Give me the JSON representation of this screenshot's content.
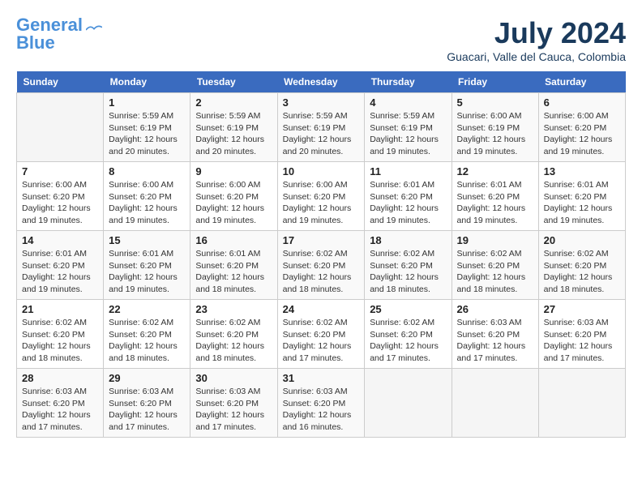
{
  "header": {
    "logo_line1": "General",
    "logo_line2": "Blue",
    "month": "July 2024",
    "location": "Guacari, Valle del Cauca, Colombia"
  },
  "weekdays": [
    "Sunday",
    "Monday",
    "Tuesday",
    "Wednesday",
    "Thursday",
    "Friday",
    "Saturday"
  ],
  "weeks": [
    [
      {
        "day": "",
        "info": ""
      },
      {
        "day": "1",
        "info": "Sunrise: 5:59 AM\nSunset: 6:19 PM\nDaylight: 12 hours\nand 20 minutes."
      },
      {
        "day": "2",
        "info": "Sunrise: 5:59 AM\nSunset: 6:19 PM\nDaylight: 12 hours\nand 20 minutes."
      },
      {
        "day": "3",
        "info": "Sunrise: 5:59 AM\nSunset: 6:19 PM\nDaylight: 12 hours\nand 20 minutes."
      },
      {
        "day": "4",
        "info": "Sunrise: 5:59 AM\nSunset: 6:19 PM\nDaylight: 12 hours\nand 19 minutes."
      },
      {
        "day": "5",
        "info": "Sunrise: 6:00 AM\nSunset: 6:19 PM\nDaylight: 12 hours\nand 19 minutes."
      },
      {
        "day": "6",
        "info": "Sunrise: 6:00 AM\nSunset: 6:20 PM\nDaylight: 12 hours\nand 19 minutes."
      }
    ],
    [
      {
        "day": "7",
        "info": "Sunrise: 6:00 AM\nSunset: 6:20 PM\nDaylight: 12 hours\nand 19 minutes."
      },
      {
        "day": "8",
        "info": "Sunrise: 6:00 AM\nSunset: 6:20 PM\nDaylight: 12 hours\nand 19 minutes."
      },
      {
        "day": "9",
        "info": "Sunrise: 6:00 AM\nSunset: 6:20 PM\nDaylight: 12 hours\nand 19 minutes."
      },
      {
        "day": "10",
        "info": "Sunrise: 6:00 AM\nSunset: 6:20 PM\nDaylight: 12 hours\nand 19 minutes."
      },
      {
        "day": "11",
        "info": "Sunrise: 6:01 AM\nSunset: 6:20 PM\nDaylight: 12 hours\nand 19 minutes."
      },
      {
        "day": "12",
        "info": "Sunrise: 6:01 AM\nSunset: 6:20 PM\nDaylight: 12 hours\nand 19 minutes."
      },
      {
        "day": "13",
        "info": "Sunrise: 6:01 AM\nSunset: 6:20 PM\nDaylight: 12 hours\nand 19 minutes."
      }
    ],
    [
      {
        "day": "14",
        "info": "Sunrise: 6:01 AM\nSunset: 6:20 PM\nDaylight: 12 hours\nand 19 minutes."
      },
      {
        "day": "15",
        "info": "Sunrise: 6:01 AM\nSunset: 6:20 PM\nDaylight: 12 hours\nand 19 minutes."
      },
      {
        "day": "16",
        "info": "Sunrise: 6:01 AM\nSunset: 6:20 PM\nDaylight: 12 hours\nand 18 minutes."
      },
      {
        "day": "17",
        "info": "Sunrise: 6:02 AM\nSunset: 6:20 PM\nDaylight: 12 hours\nand 18 minutes."
      },
      {
        "day": "18",
        "info": "Sunrise: 6:02 AM\nSunset: 6:20 PM\nDaylight: 12 hours\nand 18 minutes."
      },
      {
        "day": "19",
        "info": "Sunrise: 6:02 AM\nSunset: 6:20 PM\nDaylight: 12 hours\nand 18 minutes."
      },
      {
        "day": "20",
        "info": "Sunrise: 6:02 AM\nSunset: 6:20 PM\nDaylight: 12 hours\nand 18 minutes."
      }
    ],
    [
      {
        "day": "21",
        "info": "Sunrise: 6:02 AM\nSunset: 6:20 PM\nDaylight: 12 hours\nand 18 minutes."
      },
      {
        "day": "22",
        "info": "Sunrise: 6:02 AM\nSunset: 6:20 PM\nDaylight: 12 hours\nand 18 minutes."
      },
      {
        "day": "23",
        "info": "Sunrise: 6:02 AM\nSunset: 6:20 PM\nDaylight: 12 hours\nand 18 minutes."
      },
      {
        "day": "24",
        "info": "Sunrise: 6:02 AM\nSunset: 6:20 PM\nDaylight: 12 hours\nand 17 minutes."
      },
      {
        "day": "25",
        "info": "Sunrise: 6:02 AM\nSunset: 6:20 PM\nDaylight: 12 hours\nand 17 minutes."
      },
      {
        "day": "26",
        "info": "Sunrise: 6:03 AM\nSunset: 6:20 PM\nDaylight: 12 hours\nand 17 minutes."
      },
      {
        "day": "27",
        "info": "Sunrise: 6:03 AM\nSunset: 6:20 PM\nDaylight: 12 hours\nand 17 minutes."
      }
    ],
    [
      {
        "day": "28",
        "info": "Sunrise: 6:03 AM\nSunset: 6:20 PM\nDaylight: 12 hours\nand 17 minutes."
      },
      {
        "day": "29",
        "info": "Sunrise: 6:03 AM\nSunset: 6:20 PM\nDaylight: 12 hours\nand 17 minutes."
      },
      {
        "day": "30",
        "info": "Sunrise: 6:03 AM\nSunset: 6:20 PM\nDaylight: 12 hours\nand 17 minutes."
      },
      {
        "day": "31",
        "info": "Sunrise: 6:03 AM\nSunset: 6:20 PM\nDaylight: 12 hours\nand 16 minutes."
      },
      {
        "day": "",
        "info": ""
      },
      {
        "day": "",
        "info": ""
      },
      {
        "day": "",
        "info": ""
      }
    ]
  ]
}
